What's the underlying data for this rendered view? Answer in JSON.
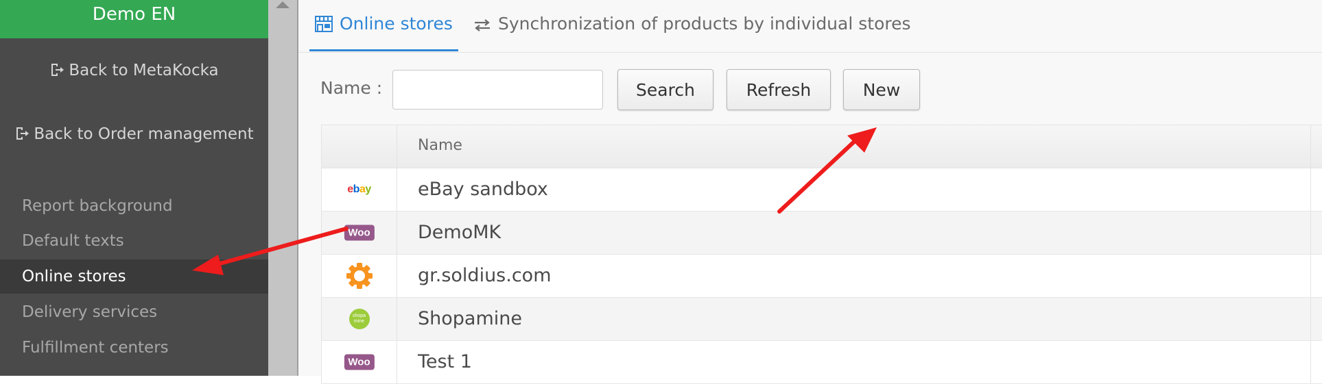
{
  "sidebar": {
    "brand": "Demo EN",
    "back_links": [
      {
        "label": "Back to MetaKocka",
        "icon": "sign-out-icon"
      },
      {
        "label": "Back to Order management",
        "icon": "sign-out-icon"
      }
    ],
    "items": [
      {
        "label": "Report background",
        "active": false
      },
      {
        "label": "Default texts",
        "active": false
      },
      {
        "label": "Online stores",
        "active": true
      },
      {
        "label": "Delivery services",
        "active": false
      },
      {
        "label": "Fulfillment centers",
        "active": false
      }
    ]
  },
  "tabs": [
    {
      "label": "Online stores",
      "icon": "storefront-icon",
      "active": true
    },
    {
      "label": "Synchronization of products by individual stores",
      "icon": "exchange-arrows-icon",
      "active": false
    }
  ],
  "filter": {
    "name_label": "Name :",
    "name_value": "",
    "search_label": "Search",
    "refresh_label": "Refresh",
    "new_label": "New"
  },
  "table": {
    "header": {
      "name": "Name"
    },
    "rows": [
      {
        "logo": "ebay",
        "logo_text": "ebay",
        "name": "eBay sandbox"
      },
      {
        "logo": "woocommerce",
        "logo_text": "Woo",
        "name": "DemoMK"
      },
      {
        "logo": "gear",
        "name": "gr.soldius.com"
      },
      {
        "logo": "shopamine",
        "logo_text": "shopa mine",
        "name": "Shopamine"
      },
      {
        "logo": "woocommerce",
        "logo_text": "Woo",
        "name": "Test 1"
      }
    ]
  },
  "colors": {
    "brand_green": "#34a853",
    "sidebar_bg": "#4a4a4a",
    "accent_blue": "#2f86d6",
    "annotation_red": "#ee1c1c",
    "woo_purple": "#96588a",
    "gear_orange": "#f7931e"
  }
}
